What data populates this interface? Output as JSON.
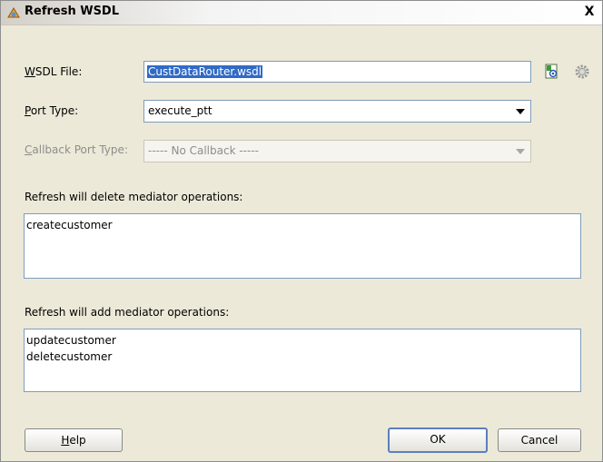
{
  "dialog": {
    "title": "Refresh WSDL",
    "close_label": "X"
  },
  "wsdl_file": {
    "mnemonic": "W",
    "label_rest": "SDL File:",
    "value": "CustDataRouter.wsdl",
    "browse_icon": "browse-wsdl-icon",
    "settings_icon": "gear-icon"
  },
  "port_type": {
    "mnemonic": "P",
    "label_rest": "ort Type:",
    "value": "execute_ptt"
  },
  "callback_port_type": {
    "mnemonic": "C",
    "label_rest": "allback Port Type:",
    "value": "----- No Callback -----",
    "disabled": true
  },
  "delete_ops": {
    "label": "Refresh will delete mediator operations:",
    "items": [
      "createcustomer"
    ]
  },
  "add_ops": {
    "label": "Refresh will add mediator operations:",
    "items": [
      "updatecustomer",
      "deletecustomer"
    ]
  },
  "buttons": {
    "help_mnemonic": "H",
    "help_rest": "elp",
    "ok": "OK",
    "cancel": "Cancel"
  },
  "colors": {
    "dialog_bg": "#ece9d8",
    "selection": "#316ac5",
    "field_border": "#7f9db9"
  }
}
